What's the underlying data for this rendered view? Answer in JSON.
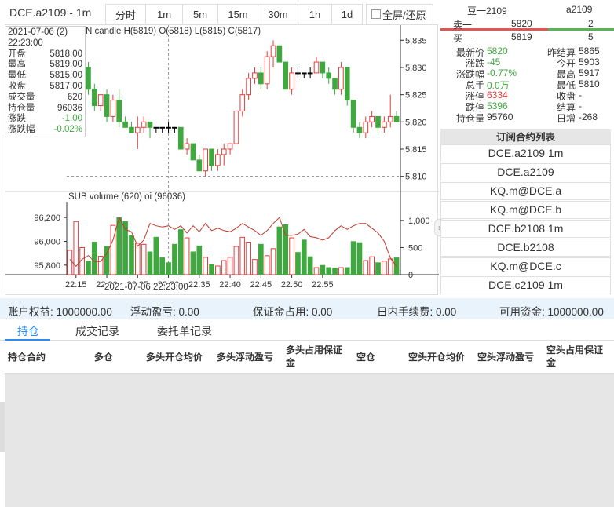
{
  "toolbar": {
    "symbol_period": "DCE.a2109 - 1m",
    "periods": [
      "分时",
      "1m",
      "5m",
      "15m",
      "30m",
      "1h",
      "1d"
    ],
    "fullscreen": "全屏/还原"
  },
  "info": {
    "date": "2021-07-06 (2)",
    "time": "22:23:00",
    "rows": [
      {
        "label": "开盘",
        "value": "5818.00"
      },
      {
        "label": "最高",
        "value": "5819.00"
      },
      {
        "label": "最低",
        "value": "5815.00"
      },
      {
        "label": "收盘",
        "value": "5817.00"
      },
      {
        "label": "成交量",
        "value": "620"
      },
      {
        "label": "持仓量",
        "value": "96036"
      },
      {
        "label": "涨跌",
        "value": "-1.00"
      },
      {
        "label": "涨跌幅",
        "value": "-0.02%"
      }
    ]
  },
  "chart_labels": {
    "main": "N candle H(5819) O(5818) L(5815) C(5817)",
    "sub": "SUB volume (620) oi (96036)",
    "crosshair_time": "2021-07-06 22:23:00"
  },
  "chart_data": {
    "type": "candlestick",
    "price_ticks": [
      "5,835",
      "5,830",
      "5,825",
      "5,820",
      "5,815",
      "5,810"
    ],
    "price_range": [
      5807.5,
      5837.5
    ],
    "marked_price": 5810,
    "oi_ticks": [
      "96,200",
      "96,000",
      "95,800"
    ],
    "vol_ticks": [
      "1,000",
      "500",
      "0"
    ],
    "time_ticks": [
      "22:15",
      "22:20",
      "22:25",
      "22:30",
      "22:35",
      "22:40",
      "22:45",
      "22:50",
      "22:55"
    ],
    "colors": {
      "up": "#e23b3b",
      "down": "#3fa93f",
      "oi": "#c0392b"
    },
    "candles": [
      [
        5822,
        5828,
        5821,
        5827
      ],
      [
        5827,
        5829,
        5826,
        5828
      ],
      [
        5828,
        5830,
        5827,
        5830
      ],
      [
        5830,
        5831,
        5825,
        5826
      ],
      [
        5826,
        5827,
        5822,
        5823
      ],
      [
        5823,
        5825,
        5822,
        5825
      ],
      [
        5825,
        5826,
        5820,
        5821
      ],
      [
        5821,
        5825,
        5820,
        5824
      ],
      [
        5824,
        5826,
        5819,
        5820
      ],
      [
        5820,
        5821,
        5819,
        5819
      ],
      [
        5819,
        5820,
        5818,
        5818
      ],
      [
        5818,
        5821,
        5815,
        5819
      ],
      [
        5819,
        5821,
        5818,
        5820
      ],
      [
        5820,
        5820,
        5817,
        5819
      ],
      [
        5819,
        5819,
        5818,
        5819
      ],
      [
        5819,
        5819,
        5818,
        5819
      ],
      [
        5819,
        5820,
        5818,
        5819
      ],
      [
        5819,
        5819,
        5818,
        5819
      ],
      [
        5819,
        5819,
        5815,
        5815
      ],
      [
        5815,
        5817,
        5814,
        5816
      ],
      [
        5816,
        5816,
        5813,
        5813
      ],
      [
        5813,
        5814,
        5811,
        5811
      ],
      [
        5811,
        5815,
        5810,
        5815
      ],
      [
        5815,
        5815,
        5811,
        5812
      ],
      [
        5812,
        5815,
        5811,
        5814
      ],
      [
        5814,
        5816,
        5812,
        5815
      ],
      [
        5815,
        5816,
        5814,
        5816
      ],
      [
        5816,
        5822,
        5816,
        5822
      ],
      [
        5822,
        5826,
        5821,
        5825
      ],
      [
        5825,
        5829,
        5824,
        5828
      ],
      [
        5828,
        5830,
        5827,
        5829
      ],
      [
        5829,
        5830,
        5826,
        5827
      ],
      [
        5827,
        5833,
        5826,
        5832
      ],
      [
        5832,
        5835,
        5830,
        5834
      ],
      [
        5834,
        5834,
        5831,
        5831
      ],
      [
        5831,
        5831,
        5826,
        5826
      ],
      [
        5826,
        5830,
        5825,
        5829
      ],
      [
        5829,
        5830,
        5828,
        5829
      ],
      [
        5829,
        5829,
        5828,
        5829
      ],
      [
        5829,
        5830,
        5828,
        5829
      ],
      [
        5829,
        5832,
        5829,
        5831
      ],
      [
        5831,
        5831,
        5828,
        5829
      ],
      [
        5829,
        5830,
        5827,
        5828
      ],
      [
        5828,
        5828,
        5825,
        5826
      ],
      [
        5826,
        5831,
        5825,
        5830
      ],
      [
        5830,
        5830,
        5823,
        5824
      ],
      [
        5824,
        5824,
        5818,
        5819
      ],
      [
        5819,
        5820,
        5817,
        5818
      ],
      [
        5818,
        5821,
        5817,
        5820
      ],
      [
        5820,
        5822,
        5819,
        5821
      ],
      [
        5821,
        5821,
        5818,
        5819
      ],
      [
        5819,
        5821,
        5818,
        5820
      ],
      [
        5820,
        5825,
        5819,
        5821
      ],
      [
        5821,
        5822,
        5820,
        5820
      ]
    ],
    "volumes": [
      450,
      980,
      500,
      250,
      600,
      340,
      520,
      910,
      1050,
      980,
      720,
      580,
      560,
      420,
      690,
      310,
      220,
      560,
      830,
      680,
      420,
      530,
      320,
      190,
      160,
      260,
      320,
      520,
      690,
      600,
      280,
      560,
      350,
      480,
      880,
      920,
      680,
      410,
      640,
      330,
      130,
      170,
      130,
      120,
      130,
      130,
      610,
      590,
      260,
      330,
      220,
      250,
      290,
      310
    ],
    "oi": [
      95850,
      95790,
      95850,
      95880,
      95830,
      95830,
      95900,
      96010,
      96200,
      96100,
      96080,
      95960,
      96010,
      96150,
      96130,
      96120,
      96130,
      96100,
      96130,
      96070,
      96130,
      96080,
      96150,
      96090,
      96110,
      96090,
      96080,
      96110,
      96150,
      96120,
      96090,
      96050,
      96090,
      96150,
      96200,
      96050,
      96050,
      96060,
      96100,
      96040,
      96030,
      96010,
      96030,
      96090,
      96130,
      96100,
      96130,
      96150,
      96150,
      96110,
      96070,
      96000,
      95860,
      95790
    ]
  },
  "orderbook": {
    "name": "豆一2109",
    "symbol": "a2109",
    "ask_label": "卖一",
    "ask_price": "5820",
    "ask_vol": "2",
    "bid_label": "买一",
    "bid_price": "5819",
    "bid_vol": "5"
  },
  "quotes": [
    {
      "label": "最新价",
      "value": "5820",
      "color": "green",
      "label2": "昨结算",
      "value2": "5865"
    },
    {
      "label": "涨跌",
      "value": "-45",
      "color": "green",
      "label2": "今开",
      "value2": "5903"
    },
    {
      "label": "涨跌幅",
      "value": "-0.77%",
      "color": "green",
      "label2": "最高",
      "value2": "5917"
    },
    {
      "label": "总手",
      "value": "0.0万",
      "color": "green",
      "label2": "最低",
      "value2": "5810"
    },
    {
      "label": "涨停",
      "value": "6334",
      "color": "red",
      "label2": "收盘",
      "value2": "-"
    },
    {
      "label": "跌停",
      "value": "5396",
      "color": "green",
      "label2": "结算",
      "value2": "-"
    },
    {
      "label": "持仓量",
      "value": "95760",
      "color": "",
      "label2": "日增",
      "value2": "-268"
    }
  ],
  "subscriptions": {
    "title": "订阅合约列表",
    "items": [
      "DCE.a2109 1m",
      "DCE.a2109",
      "KQ.m@DCE.a",
      "KQ.m@DCE.b",
      "DCE.b2108 1m",
      "DCE.b2108",
      "KQ.m@DCE.c",
      "DCE.c2109 1m"
    ]
  },
  "account": {
    "equity": "账户权益: 1000000.00",
    "float_pnl": "浮动盈亏: 0.00",
    "margin": "保证金占用: 0.00",
    "fee": "日内手续费: 0.00",
    "available": "可用资金: 1000000.00"
  },
  "tabs": [
    "持仓",
    "成交记录",
    "委托单记录"
  ],
  "table_headers": [
    "持仓合约",
    "多仓",
    "多头开仓均价",
    "多头浮动盈亏",
    "多头占用保证金",
    "空仓",
    "空头开仓均价",
    "空头浮动盈亏",
    "空头占用保证金"
  ]
}
